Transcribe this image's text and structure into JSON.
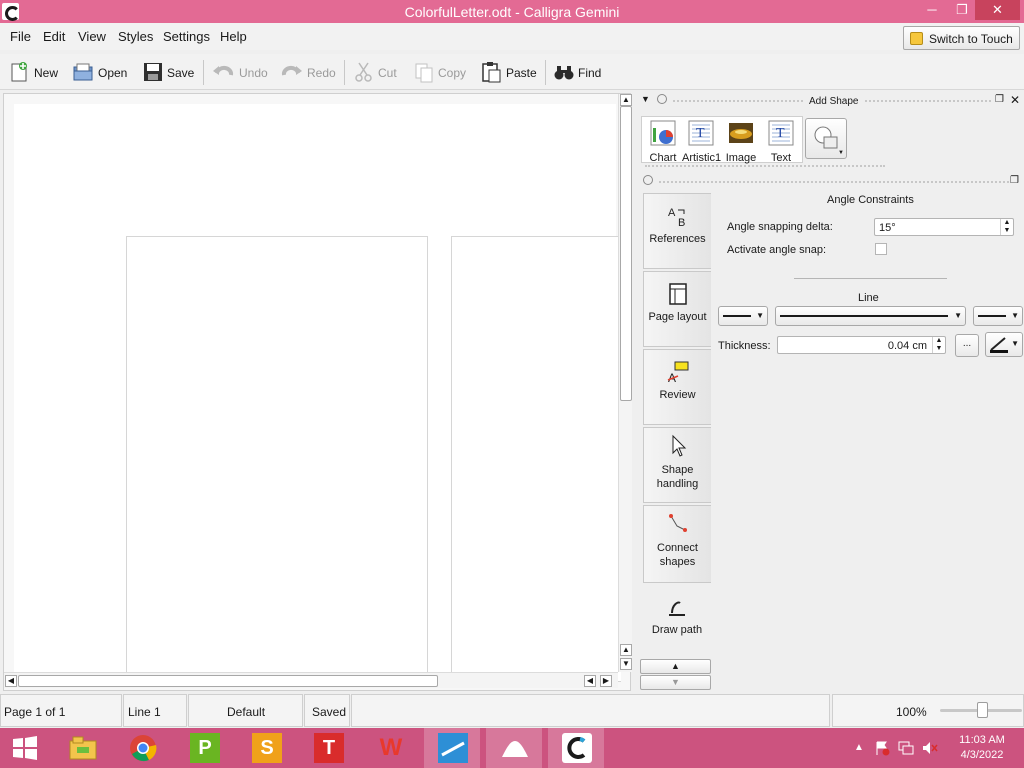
{
  "window": {
    "title": "ColorfulLetter.odt - Calligra Gemini",
    "minimize": "─",
    "maximize": "❐",
    "close": "✕"
  },
  "menu": {
    "items": [
      "File",
      "Edit",
      "View",
      "Styles",
      "Settings",
      "Help"
    ],
    "switch_to_touch": "Switch to Touch"
  },
  "toolbar": {
    "new": "New",
    "open": "Open",
    "save": "Save",
    "undo": "Undo",
    "redo": "Redo",
    "cut": "Cut",
    "copy": "Copy",
    "paste": "Paste",
    "find": "Find"
  },
  "add_shape": {
    "title": "Add Shape",
    "items": [
      "Chart",
      "Artistic1",
      "Image",
      "Text"
    ]
  },
  "tool_tabs": [
    "References",
    "Page layout",
    "Review",
    "Shape handling",
    "Connect shapes",
    "Draw path"
  ],
  "options": {
    "angle_constraints_title": "Angle Constraints",
    "angle_snapping_delta_label": "Angle snapping delta:",
    "angle_snapping_delta_value": "15°",
    "activate_angle_snap_label": "Activate angle snap:",
    "activate_angle_snap_checked": false,
    "line_title": "Line",
    "thickness_label": "Thickness:",
    "thickness_value": "0.04 cm",
    "more_button": "..."
  },
  "status": {
    "page": "Page 1 of 1",
    "line": "Line 1",
    "style": "Default",
    "saved": "Saved",
    "zoom": "100%",
    "zoom_slider_fraction": 0.5
  },
  "taskbar": {
    "apps": [
      "start",
      "file-explorer",
      "chrome",
      "p-app",
      "s-app",
      "t-app",
      "w-app",
      "calligra-words",
      "calligra-stage",
      "calligra-gemini"
    ],
    "clock_time": "11:03 AM",
    "clock_date": "4/3/2022"
  },
  "colors": {
    "titlebar": "#e36a94",
    "taskbar": "#cc537f",
    "close": "#c8435d"
  }
}
